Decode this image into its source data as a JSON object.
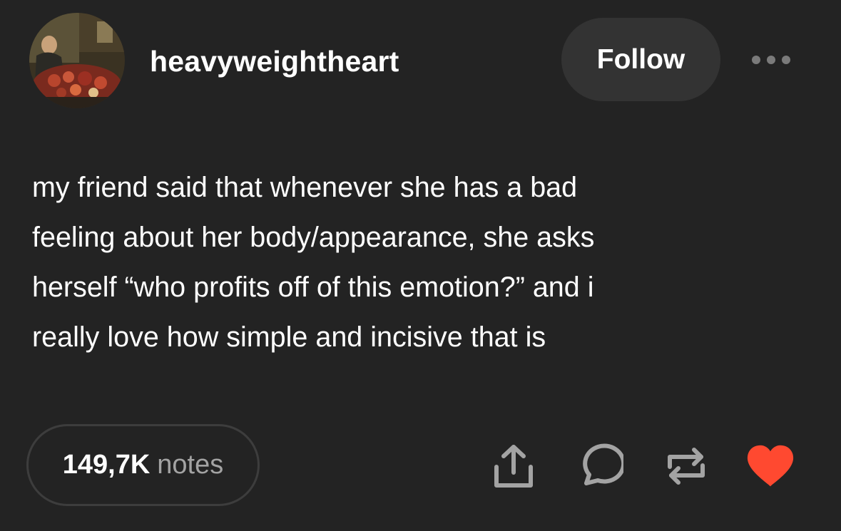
{
  "post": {
    "username": "heavyweightheart",
    "follow_label": "Follow",
    "body_lines": [
      "my friend said that whenever she has a bad",
      "feeling about her body/appearance, she asks",
      "herself “who profits off of this emotion?” and i",
      "really love how simple and incisive that is"
    ]
  },
  "footer": {
    "notes_count": "149,7K",
    "notes_label": "notes",
    "actions": [
      "share-icon",
      "reply-icon",
      "reblog-icon",
      "heart-icon"
    ]
  },
  "colors": {
    "background": "#232323",
    "follow_button": "#333333",
    "heart": "#ff4930",
    "muted_text": "#a3a3a3"
  }
}
